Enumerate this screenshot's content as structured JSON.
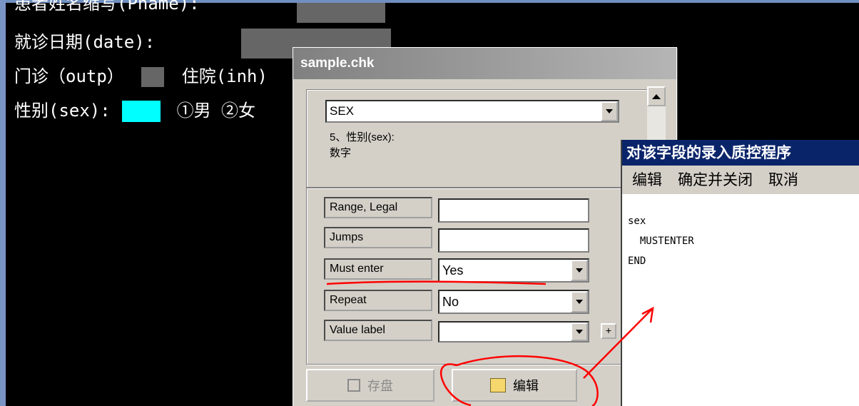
{
  "console": {
    "line0": "患者姓名缩写(Pname):",
    "line1": "就诊日期(date):",
    "line2_a": "门诊（outp）",
    "line2_b": "住院(inh)",
    "line3_a": "性别(sex):",
    "line3_b": "①男 ②女"
  },
  "window": {
    "title": "sample.chk",
    "field_select": "SEX",
    "desc_line1": "5、性别(sex):",
    "desc_line2": "数字",
    "props": [
      {
        "label": "Range, Legal",
        "value": ""
      },
      {
        "label": "Jumps",
        "value": ""
      },
      {
        "label": "Must enter",
        "value": "Yes"
      },
      {
        "label": "Repeat",
        "value": "No"
      },
      {
        "label": "Value label",
        "value": ""
      }
    ],
    "plus_label": "+",
    "save_label": "存盘",
    "edit_label": "编辑"
  },
  "editor": {
    "title": "对该字段的录入质控程序",
    "menu": [
      "编辑",
      "确定并关闭",
      "取消"
    ],
    "code_lines": [
      "sex",
      "  MUSTENTER",
      "END"
    ]
  },
  "colors": {
    "console_bg": "#000000",
    "highlight_cyan": "#00ffff",
    "annotation_red": "#ff0000",
    "title_blue": "#0a246a"
  }
}
